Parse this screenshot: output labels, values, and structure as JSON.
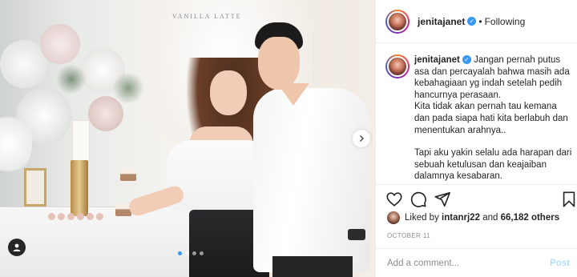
{
  "photo": {
    "watermark": "VANILLA LATTE",
    "carousel": {
      "count": 4,
      "active": 1
    }
  },
  "header": {
    "username": "jenitajanet",
    "separator": "•",
    "follow_state": "Following"
  },
  "caption": {
    "username": "jenitajanet",
    "paragraph1": "Jangan pernah putus asa dan percayalah bahwa masih ada kebahagiaan yg indah setelah pedih hancurnya perasaan.",
    "paragraph2": "Kita tidak akan pernah tau kemana dan pada siapa hati kita berlabuh dan menentukan arahnya..",
    "paragraph3": "Tapi aku yakin selalu ada harapan dari sebuah ketulusan dan keajaiban dalamnya kesabaran."
  },
  "likes": {
    "prefix": "Liked by",
    "user": "intanrj22",
    "conjunction": "and",
    "count": "66,182 others"
  },
  "date": "OCTOBER 11",
  "comment": {
    "placeholder": "Add a comment...",
    "post_label": "Post"
  },
  "colors": {
    "accent": "#3897f0",
    "post_disabled": "#b2dffc",
    "muted": "#8e8e8e",
    "text": "#262626"
  },
  "icons": [
    "heart-icon",
    "comment-icon",
    "share-icon",
    "bookmark-icon",
    "verified-icon",
    "chevron-right-icon",
    "user-tag-icon"
  ]
}
